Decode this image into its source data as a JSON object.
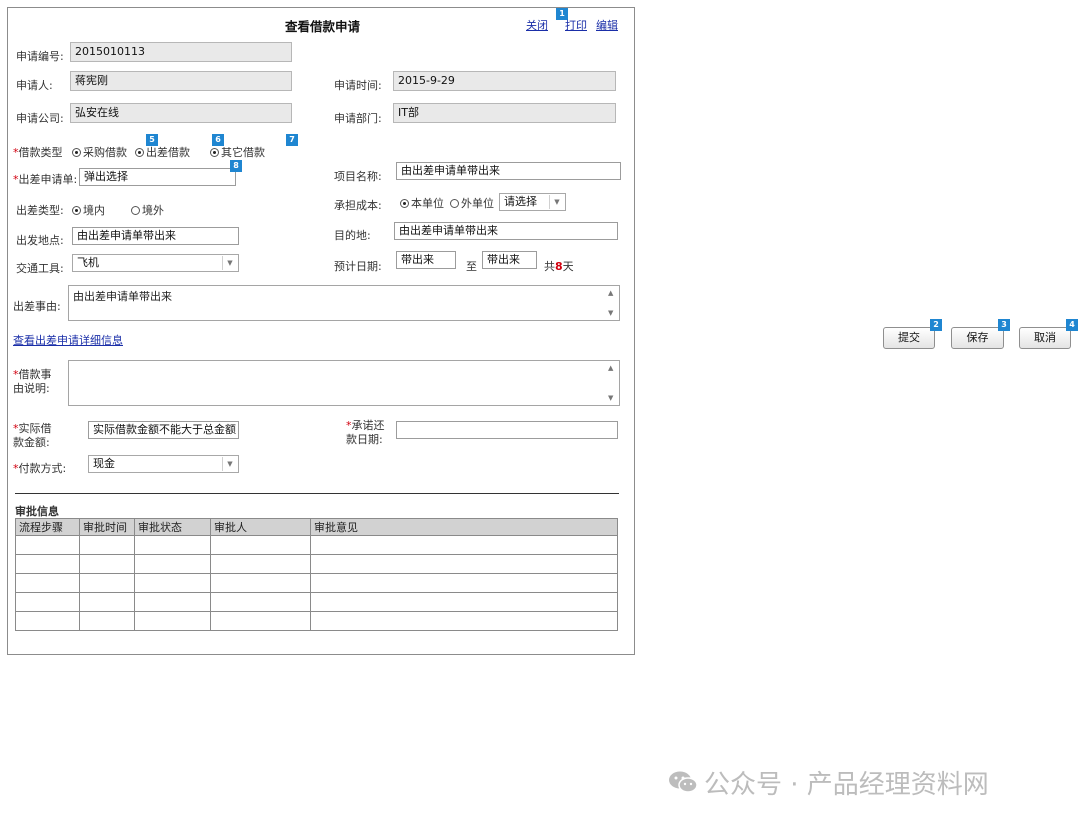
{
  "window": {
    "title": "查看借款申请",
    "links": {
      "close": "关闭",
      "print": "打印",
      "edit": "编辑"
    }
  },
  "form": {
    "app_no_label": "申请编号:",
    "app_no_value": "2015010113",
    "applicant_label": "申请人:",
    "applicant_value": "蒋宪刚",
    "app_time_label": "申请时间:",
    "app_time_value": "2015-9-29",
    "company_label": "申请公司:",
    "company_value": "弘安在线",
    "dept_label": "申请部门:",
    "dept_value": "IT部",
    "loan_type_label": "借款类型",
    "loan_type_options": [
      "采购借款",
      "出差借款",
      "其它借款"
    ],
    "trip_form_label": "出差申请单:",
    "trip_form_value": "弹出选择",
    "project_label": "项目名称:",
    "project_value": "由出差申请单带出来",
    "trip_type_label": "出差类型:",
    "trip_type_options": [
      "境内",
      "境外"
    ],
    "cost_label": "承担成本:",
    "cost_options": [
      "本单位",
      "外单位"
    ],
    "cost_select_value": "请选择",
    "depart_label": "出发地点:",
    "depart_value": "由出差申请单带出来",
    "dest_label": "目的地:",
    "dest_value": "由出差申请单带出来",
    "transport_label": "交通工具:",
    "transport_value": "飞机",
    "date_label": "预计日期:",
    "date_from": "带出来",
    "date_to_word": "至",
    "date_to": "带出来",
    "days_prefix": "共",
    "days_value": "8",
    "days_suffix": "天",
    "reason_label": "出差事由:",
    "reason_value": "由出差申请单带出来",
    "detail_link": "查看出差申请详细信息",
    "loan_reason_label_1": "借款事",
    "loan_reason_label_2": "由说明:",
    "amount_label_1": "实际借",
    "amount_label_2": "款金额:",
    "amount_value": "实际借款金额不能大于总金额",
    "repay_label_1": "承诺还",
    "repay_label_2": "款日期:",
    "pay_method_label": "付款方式:",
    "pay_method_value": "现金"
  },
  "approval": {
    "section_title": "审批信息",
    "columns": [
      "流程步骤",
      "审批时间",
      "审批状态",
      "审批人",
      "审批意见"
    ]
  },
  "actions": {
    "submit": "提交",
    "save": "保存",
    "cancel": "取消"
  },
  "badges": [
    "1",
    "2",
    "3",
    "4",
    "5",
    "6",
    "7",
    "8"
  ],
  "watermark": "公众号 · 产品经理资料网",
  "colors": {
    "badge": "#1f86d1",
    "link": "#1a2ea8",
    "required": "#d2000f",
    "days_number": "#d2000f"
  }
}
